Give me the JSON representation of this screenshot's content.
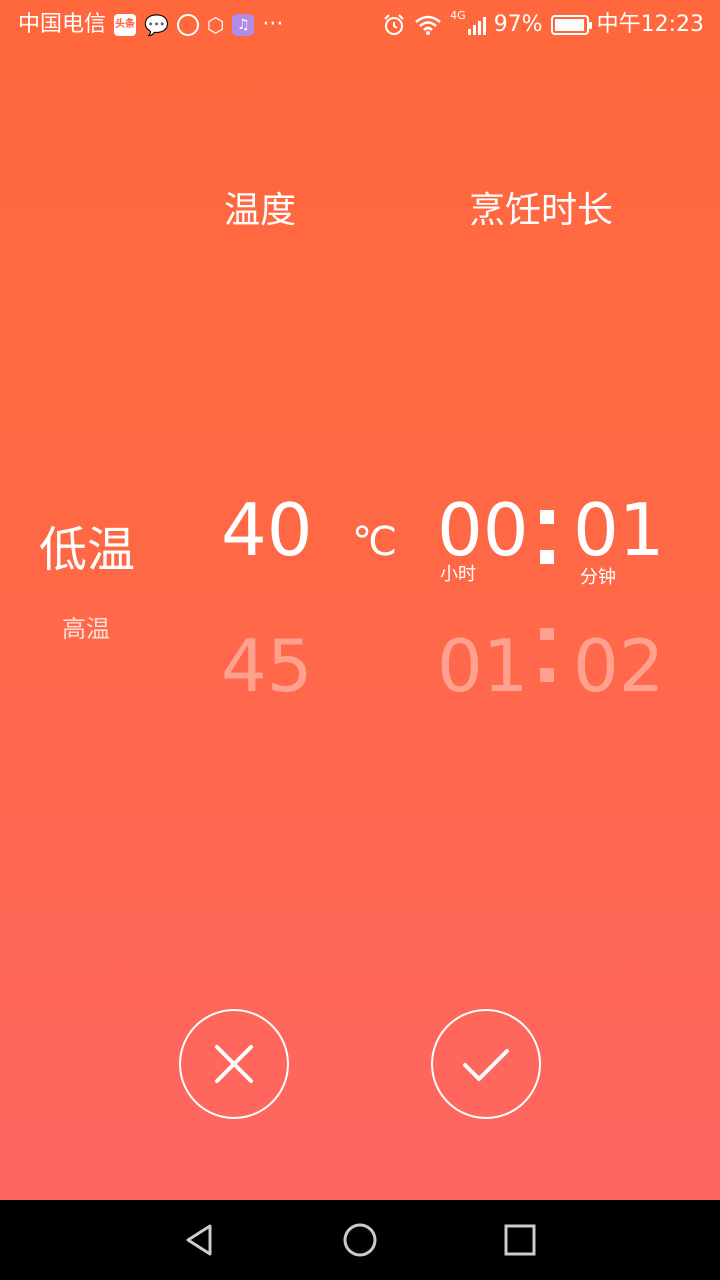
{
  "status_bar": {
    "carrier": "中国电信",
    "toutiao_badge": "头条",
    "network": "4G",
    "battery": "97%",
    "battery_level": 0.97,
    "time": "中午12:23",
    "overflow": "···"
  },
  "headers": {
    "temperature": "温度",
    "cooking_duration": "烹饪时长"
  },
  "mode_picker": {
    "selected": "低温",
    "next": "高温"
  },
  "temperature_picker": {
    "selected": "40",
    "next": "45",
    "unit": "℃"
  },
  "hour_picker": {
    "selected": "00",
    "next": "01",
    "unit": "小时"
  },
  "minute_picker": {
    "selected": "01",
    "next": "02",
    "unit": "分钟"
  },
  "colors": {
    "gradient_top": "#ff683c",
    "gradient_bottom": "#ff6662",
    "nav_bar": "#000000"
  },
  "icons": {
    "cancel": "close-icon",
    "confirm": "check-icon",
    "nav_back": "back-triangle-icon",
    "nav_home": "home-circle-icon",
    "nav_recents": "recents-square-icon"
  }
}
